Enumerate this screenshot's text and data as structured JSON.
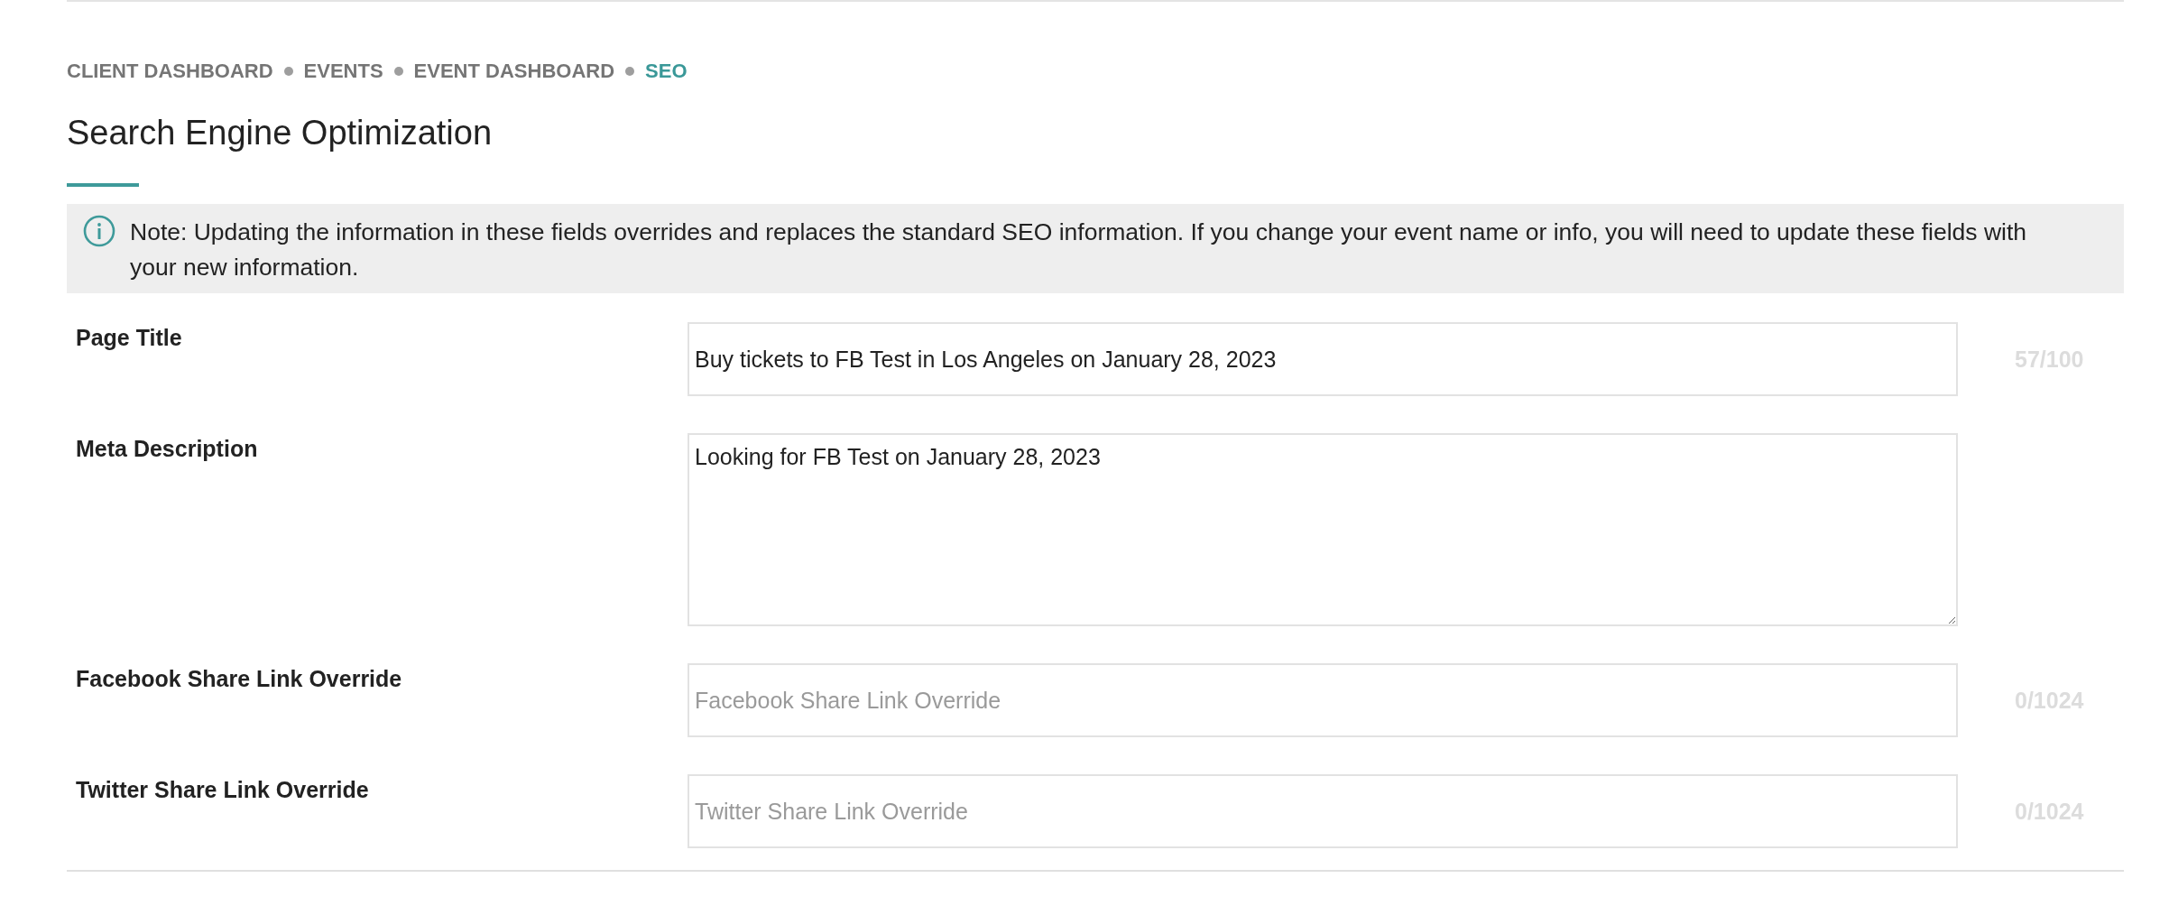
{
  "breadcrumb": [
    {
      "label": "CLIENT DASHBOARD",
      "selected": false
    },
    {
      "label": "EVENTS",
      "selected": false
    },
    {
      "label": "EVENT DASHBOARD",
      "selected": false
    },
    {
      "label": "SEO",
      "selected": true
    }
  ],
  "title": "Search Engine Optimization",
  "note": {
    "text": "Note: Updating the information in these fields overrides and replaces the standard SEO information. If you change your event name or info, you will need to update these fields with your new information."
  },
  "fields": [
    {
      "kind": "input",
      "label": "Page Title",
      "value": "Buy tickets to FB Test in Los Angeles on January 28, 2023",
      "counter": "57/100"
    },
    {
      "kind": "textarea",
      "label": "Meta Description",
      "value": "Looking for FB Test on January 28, 2023"
    },
    {
      "kind": "input",
      "label": "Facebook Share Link Override",
      "placeholder": "Facebook Share Link Override",
      "counter": "0/1024"
    },
    {
      "kind": "input",
      "label": "Twitter Share Link Override",
      "placeholder": "Twitter Share Link Override",
      "counter": "0/1024"
    }
  ]
}
